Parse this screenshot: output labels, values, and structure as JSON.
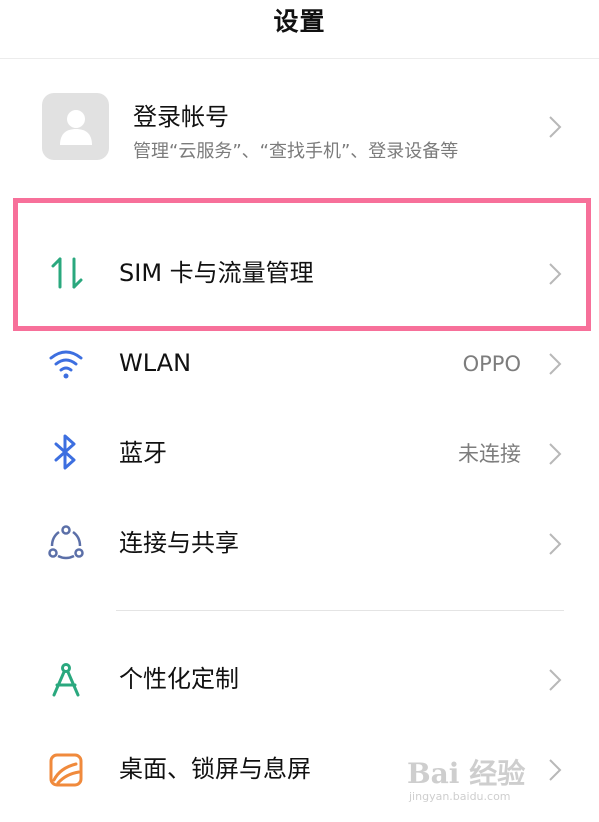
{
  "header": {
    "title": "设置"
  },
  "account": {
    "name": "登录帐号",
    "subtitle": "管理“云服务”、“查找手机”、登录设备等"
  },
  "rows": [
    {
      "label": "SIM 卡与流量管理",
      "value": "",
      "icon": "sim-data-arrows-icon"
    },
    {
      "label": "WLAN",
      "value": "OPPO",
      "icon": "wifi-icon"
    },
    {
      "label": "蓝牙",
      "value": "未连接",
      "icon": "bluetooth-icon"
    },
    {
      "label": "连接与共享",
      "value": "",
      "icon": "connection-share-icon"
    },
    {
      "label": "个性化定制",
      "value": "",
      "icon": "personalization-compass-icon"
    },
    {
      "label": "桌面、锁屏与息屏",
      "value": "",
      "icon": "wallpaper-icon"
    }
  ],
  "watermark": {
    "main": "Bai 经验",
    "sub": "jingyan.baidu.com"
  },
  "colors": {
    "highlight": "#f7709a",
    "sim_icon": "#2aa87e",
    "wifi_icon": "#3d6fe0",
    "bluetooth_icon": "#3d6fe0",
    "share_icon": "#5b6fa8",
    "personalize_icon": "#2aa87e",
    "wallpaper_icon": "#f08a3c"
  }
}
